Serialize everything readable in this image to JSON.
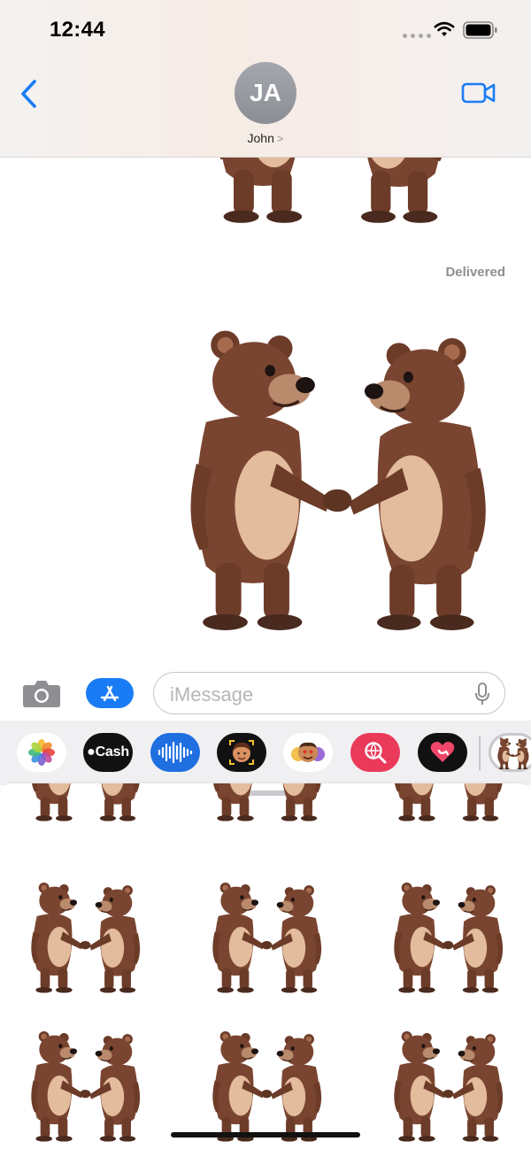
{
  "status_bar": {
    "time": "12:44",
    "icons": [
      "signal-dots-icon",
      "wifi-icon",
      "battery-icon"
    ]
  },
  "header": {
    "back_icon": "chevron-left-icon",
    "avatar_initials": "JA",
    "contact_name": "John",
    "contact_chevron": ">",
    "video_icon": "video-camera-icon"
  },
  "thread": {
    "status": "Delivered"
  },
  "input": {
    "placeholder": "iMessage",
    "camera_icon": "camera-icon",
    "apps_icon": "app-store-icon",
    "mic_icon": "microphone-icon"
  },
  "drawer": {
    "apps": [
      {
        "name": "photos-app-icon"
      },
      {
        "name": "apple-cash-app-icon",
        "label": "Cash"
      },
      {
        "name": "audio-message-app-icon"
      },
      {
        "name": "memoji-app-icon"
      },
      {
        "name": "animoji-stickers-app-icon"
      },
      {
        "name": "search-images-app-icon"
      },
      {
        "name": "digital-touch-app-icon"
      },
      {
        "name": "bear-stickers-app-icon"
      }
    ]
  },
  "colors": {
    "accent": "#1a7cf5",
    "bear_fur": "#7a4530",
    "bear_belly": "#e2bc9c",
    "delivered": "#8e8e93"
  }
}
